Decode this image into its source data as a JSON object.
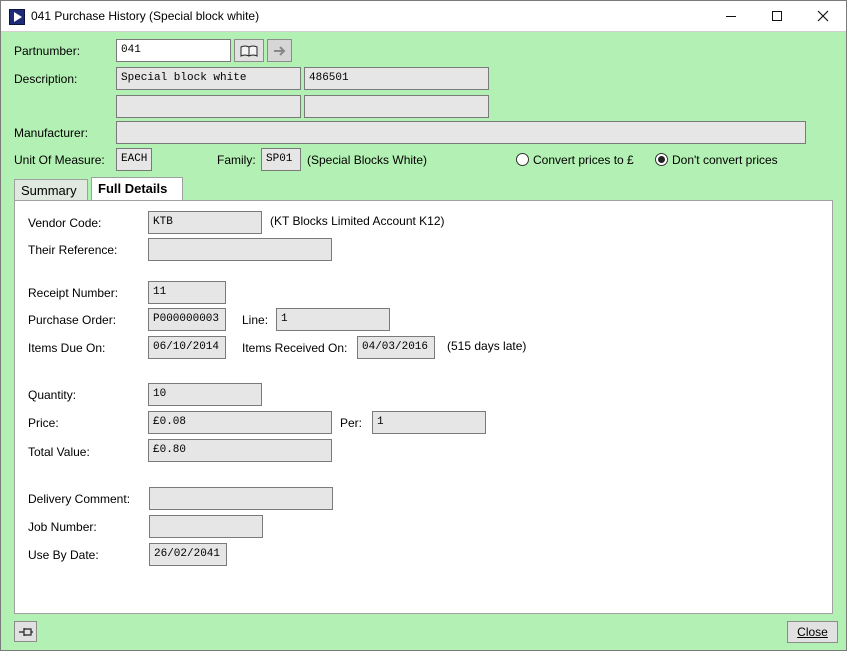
{
  "window": {
    "title": "041 Purchase History (Special block white)"
  },
  "header": {
    "partnumber_label": "Partnumber:",
    "partnumber_value": "041",
    "description_label": "Description:",
    "description_1": "Special block white",
    "description_code": "486501",
    "description_2": "",
    "description_3": "",
    "manufacturer_label": "Manufacturer:",
    "manufacturer_value": "",
    "uom_label": "Unit Of Measure:",
    "uom_value": "EACH",
    "family_label": "Family:",
    "family_value": "SP01",
    "family_desc": "(Special Blocks White)",
    "convert_label": "Convert prices to £",
    "dont_convert_label": "Don't convert prices",
    "selected_option": "dont_convert"
  },
  "tabs": [
    {
      "label": "Summary",
      "active": false
    },
    {
      "label": "Full Details",
      "active": true
    }
  ],
  "details": {
    "vendor_code_label": "Vendor Code:",
    "vendor_code": "KTB",
    "vendor_desc": "(KT Blocks Limited  Account K12)",
    "their_ref_label": "Their Reference:",
    "their_ref": "",
    "receipt_label": "Receipt Number:",
    "receipt": "11",
    "po_label": "Purchase Order:",
    "po": "P000000003",
    "line_label": "Line:",
    "line": "1",
    "due_label": "Items Due On:",
    "due": "06/10/2014",
    "received_label": "Items Received On:",
    "received": "04/03/2016",
    "late_note": "(515 days late)",
    "qty_label": "Quantity:",
    "qty": "10",
    "price_label": "Price:",
    "price": "£0.08",
    "per_label": "Per:",
    "per": "1",
    "total_label": "Total Value:",
    "total": "£0.80",
    "delivery_label": "Delivery Comment:",
    "delivery": "",
    "job_label": "Job Number:",
    "job": "",
    "useby_label": "Use By Date:",
    "useby": "26/02/2041"
  },
  "footer": {
    "close_label": "Close"
  }
}
